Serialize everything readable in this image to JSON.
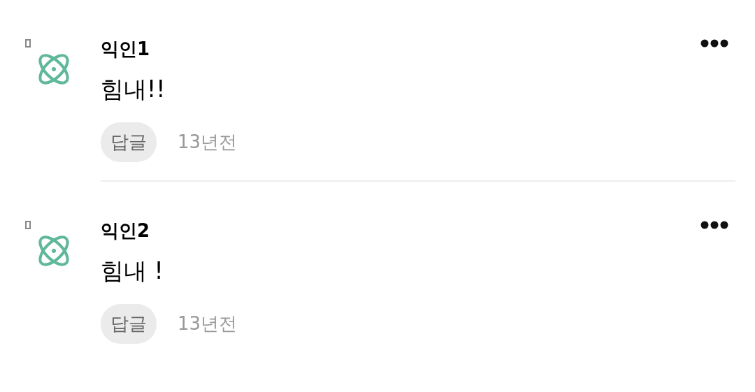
{
  "comments": [
    {
      "author": "익인1",
      "text": "힘내!!",
      "reply_label": "답글",
      "time": "13년전"
    },
    {
      "author": "익인2",
      "text": "힘내 !",
      "reply_label": "답글",
      "time": "13년전"
    }
  ]
}
